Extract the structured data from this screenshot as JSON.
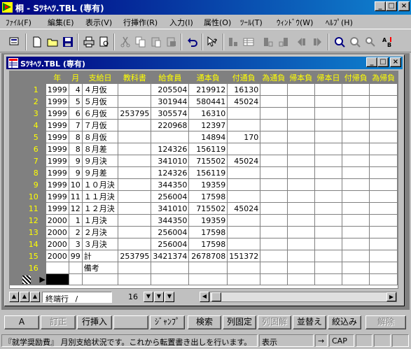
{
  "window": {
    "title": "桐 - Sﾂｷﾍﾂ.TBL (専有)"
  },
  "menu": [
    "ﾌｧｲﾙ(F)",
    "編集(E)",
    "表示(V)",
    "行挿作(R)",
    "入力(I)",
    "属性(O)",
    "ﾂｰﾙ(T)",
    "ｳｨﾝﾄﾞｳ(W)",
    "ﾍﾙﾌﾟ(H)"
  ],
  "child": {
    "title": "Sﾂｷﾍﾂ.TBL (専有)"
  },
  "grid": {
    "columns": [
      "年",
      "月",
      "支給日",
      "教科書",
      "給食員",
      "通本負",
      "付通負",
      "為通負",
      "帰本負",
      "帰本日",
      "付帰負",
      "為帰負"
    ],
    "rows": [
      {
        "num": "1",
        "cells": [
          "1999",
          "4",
          "４月仮",
          "",
          "205504",
          "219912",
          "16130"
        ]
      },
      {
        "num": "2",
        "cells": [
          "1999",
          "5",
          "５月仮",
          "",
          "301944",
          "580441",
          "45024"
        ]
      },
      {
        "num": "3",
        "cells": [
          "1999",
          "6",
          "６月仮",
          "253795",
          "305574",
          "16310",
          ""
        ]
      },
      {
        "num": "4",
        "cells": [
          "1999",
          "7",
          "７月仮",
          "",
          "220968",
          "12397",
          ""
        ]
      },
      {
        "num": "5",
        "cells": [
          "1999",
          "8",
          "８月仮",
          "",
          "",
          "14894",
          "170"
        ]
      },
      {
        "num": "6",
        "cells": [
          "1999",
          "8",
          "８月差",
          "",
          "124326",
          "156119",
          ""
        ]
      },
      {
        "num": "7",
        "cells": [
          "1999",
          "9",
          "９月決",
          "",
          "341010",
          "715502",
          "45024"
        ]
      },
      {
        "num": "8",
        "cells": [
          "1999",
          "9",
          "９月差",
          "",
          "124326",
          "156119",
          ""
        ]
      },
      {
        "num": "9",
        "cells": [
          "1999",
          "10",
          "１０月決",
          "",
          "344350",
          "19359",
          ""
        ]
      },
      {
        "num": "10",
        "cells": [
          "1999",
          "11",
          "１１月決",
          "",
          "256004",
          "17598",
          ""
        ]
      },
      {
        "num": "11",
        "cells": [
          "1999",
          "12",
          "１２月決",
          "",
          "341010",
          "715502",
          "45024"
        ]
      },
      {
        "num": "12",
        "cells": [
          "2000",
          "1",
          "１月決",
          "",
          "344350",
          "19359",
          ""
        ]
      },
      {
        "num": "13",
        "cells": [
          "2000",
          "2",
          "２月決",
          "",
          "256004",
          "17598",
          ""
        ]
      },
      {
        "num": "14",
        "cells": [
          "2000",
          "3",
          "３月決",
          "",
          "256004",
          "17598",
          ""
        ]
      },
      {
        "num": "15",
        "cells": [
          "2000",
          "99",
          "計",
          "253795",
          "3421374",
          "2678708",
          "151372"
        ]
      },
      {
        "num": "16",
        "cells": [
          "",
          "",
          "備考",
          "",
          "",
          "",
          ""
        ]
      }
    ]
  },
  "pager": {
    "label": "終端行",
    "slash": "/",
    "count": "16"
  },
  "fkeys": [
    {
      "label": "A",
      "disabled": false
    },
    {
      "label": "訂正",
      "disabled": true
    },
    {
      "label": "行挿入",
      "disabled": false
    },
    {
      "label": "",
      "disabled": false
    },
    {
      "label": "ｼﾞｬﾝﾌﾟ",
      "disabled": false
    },
    {
      "label": "検索",
      "disabled": false
    },
    {
      "label": "列固定",
      "disabled": false
    },
    {
      "label": "列固解",
      "disabled": true
    },
    {
      "label": "並替え",
      "disabled": false
    },
    {
      "label": "絞込み",
      "disabled": false
    },
    {
      "label": "解除",
      "disabled": true
    }
  ],
  "status": {
    "message": "『就学奨励費』 月別支給状況です。これから転置書き出しを行います。",
    "mode": "表示",
    "arrow": "→",
    "cap": "CAP"
  }
}
